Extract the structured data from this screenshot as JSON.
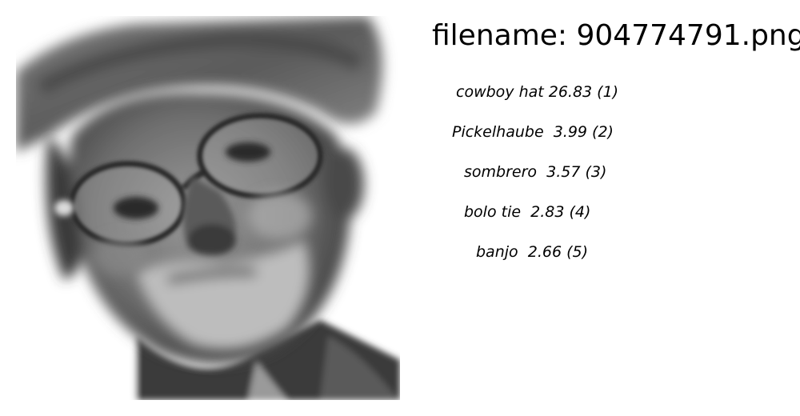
{
  "header": {
    "filename_text": "filename: 904774791.png"
  },
  "photo": {
    "subject": "elderly-man-wearing-hat-and-glasses-grayscale"
  },
  "predictions": [
    {
      "text": "cowboy hat 26.83 (1)"
    },
    {
      "text": "Pickelhaube  3.99 (2)"
    },
    {
      "text": "sombrero  3.57 (3)"
    },
    {
      "text": "bolo tie  2.83 (4)"
    },
    {
      "text": "banjo  2.66 (5)"
    }
  ]
}
